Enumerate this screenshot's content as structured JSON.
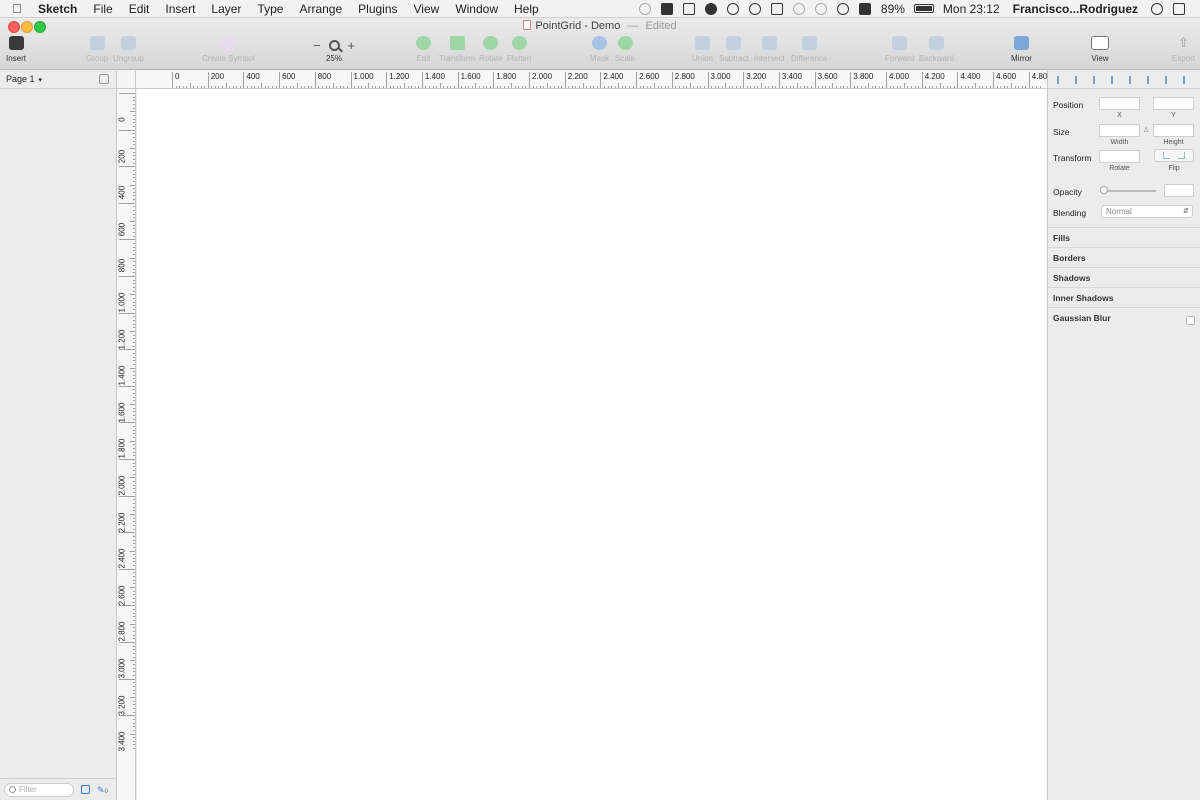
{
  "menubar": {
    "app": "Sketch",
    "menus": [
      "File",
      "Edit",
      "Insert",
      "Layer",
      "Type",
      "Arrange",
      "Plugins",
      "View",
      "Window",
      "Help"
    ],
    "battery_percent": "89%",
    "battery_level": 0.89,
    "clock": "Mon 23:12",
    "user": "Francisco...Rodriguez"
  },
  "window": {
    "title": "PointGrid - Demo",
    "title_separator": "—",
    "status": "Edited"
  },
  "toolbar": {
    "insert": "Insert",
    "group": "Group",
    "ungroup": "Ungroup",
    "create_symbol": "Create Symbol",
    "zoom_out": "−",
    "zoom_in": "+",
    "zoom_level": "25%",
    "edit": "Edit",
    "transform": "Transform",
    "rotate": "Rotate",
    "flatten": "Flatten",
    "mask": "Mask",
    "scale": "Scale",
    "union": "Union",
    "subtract": "Subtract",
    "intersect": "Intersect",
    "difference": "Difference",
    "forward": "Forward",
    "backward": "Backward",
    "mirror": "Mirror",
    "view": "View",
    "export": "Export"
  },
  "left_panel": {
    "page": "Page 1",
    "filter_placeholder": "Filter",
    "layer_count": "0"
  },
  "rulers": {
    "horizontal": [
      "0",
      "200",
      "400",
      "600",
      "800",
      "1.000",
      "1.200",
      "1.400",
      "1.600",
      "1.800",
      "2.000",
      "2.200",
      "2.400",
      "2.600",
      "2.800",
      "3.000",
      "3.200",
      "3.400",
      "3.600",
      "3.800",
      "4.000",
      "4.200",
      "4.400",
      "4.600",
      "4.800"
    ],
    "vertical": [
      "0",
      "200",
      "400",
      "600",
      "800",
      "1.000",
      "1.200",
      "1.400",
      "1.600",
      "1.800",
      "2.000",
      "2.200",
      "2.400",
      "2.600",
      "2.800",
      "3.000",
      "3.200",
      "3.400"
    ]
  },
  "inspector": {
    "position": "Position",
    "x": "X",
    "y": "Y",
    "size": "Size",
    "width": "Width",
    "height": "Height",
    "transform": "Transform",
    "rotate": "Rotate",
    "flip": "Flip",
    "opacity": "Opacity",
    "blending": "Blending",
    "blending_value": "Normal",
    "fills": "Fills",
    "borders": "Borders",
    "shadows": "Shadows",
    "inner_shadows": "Inner Shadows",
    "gaussian_blur": "Gaussian Blur"
  },
  "colors": {
    "accent": "#3a7bd5",
    "close": "#fc605b",
    "minimize": "#fdbc40",
    "zoom": "#34c84a"
  }
}
